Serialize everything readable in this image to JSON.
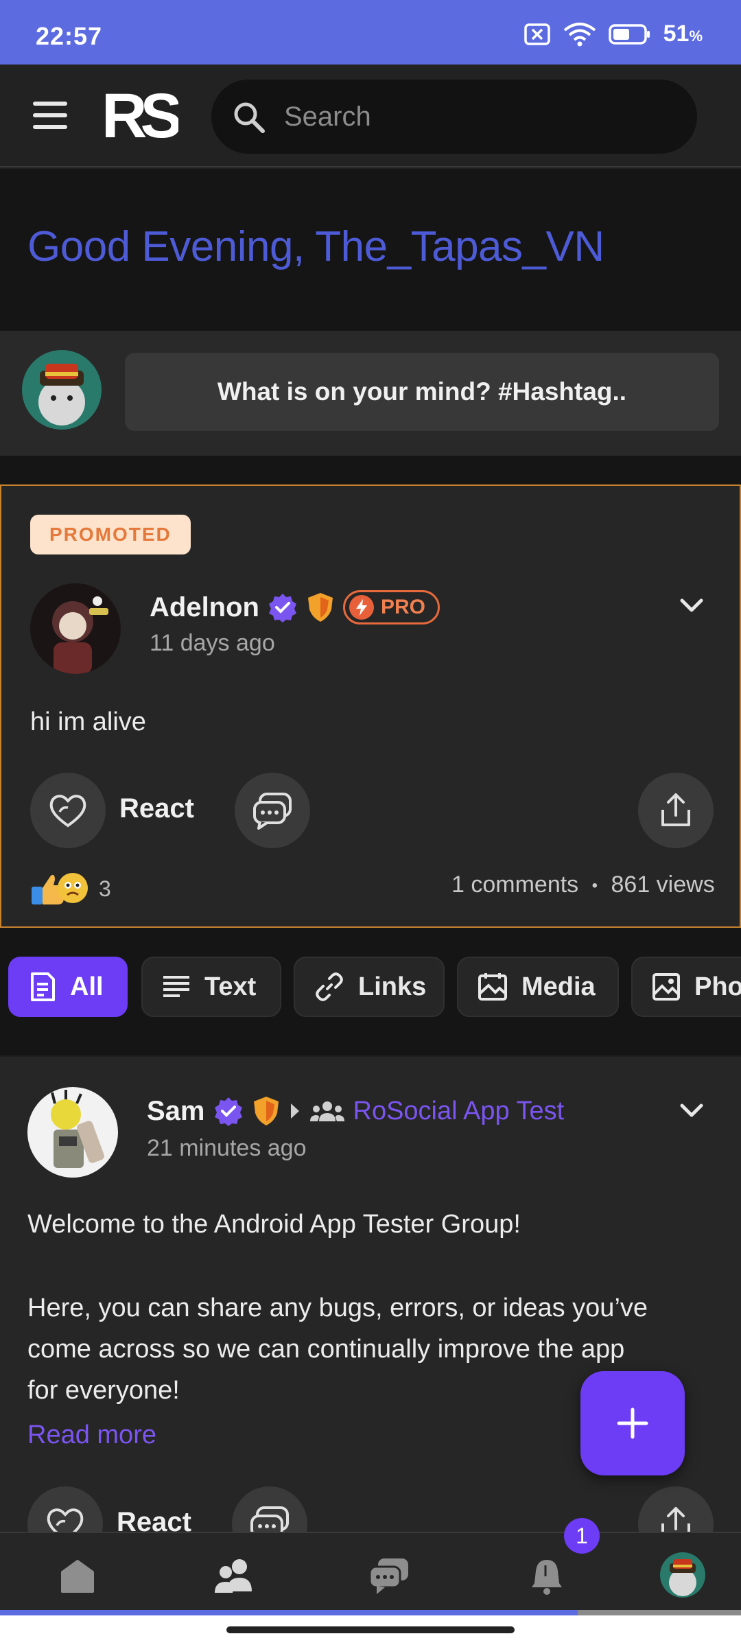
{
  "status_bar": {
    "time": "22:57",
    "battery_pct": "51",
    "battery_unit": "%"
  },
  "header": {
    "logo_text": "RS",
    "search_placeholder": "Search"
  },
  "greeting": {
    "text": "Good Evening, The_Tapas_VN"
  },
  "composer": {
    "prompt": "What is on your mind? #Hashtag.."
  },
  "promoted_post": {
    "badge": "PROMOTED",
    "author": "Adelnon",
    "pro_label": "PRO",
    "time": "11 days ago",
    "body": "hi im alive",
    "react_label": "React",
    "reaction_count": "3",
    "comments": "1 comments",
    "views": "861 views",
    "separator": "•"
  },
  "filters": [
    {
      "label": "All",
      "icon": "document-icon",
      "active": true
    },
    {
      "label": "Text",
      "icon": "text-lines-icon",
      "active": false
    },
    {
      "label": "Links",
      "icon": "link-icon",
      "active": false
    },
    {
      "label": "Media",
      "icon": "media-icon",
      "active": false
    },
    {
      "label": "Pho",
      "icon": "photo-icon",
      "active": false
    }
  ],
  "post": {
    "author": "Sam",
    "group": "RoSocial App Test",
    "time": "21 minutes ago",
    "body_line1": "Welcome to the Android App Tester Group!",
    "body_line2": "Here, you can share any bugs, errors, or ideas you’ve",
    "body_line3": "come across so we can continually improve the app",
    "body_line4": "for everyone!",
    "read_more": "Read more",
    "react_label": "React"
  },
  "bottom_nav": {
    "items": [
      "home-icon",
      "friends-icon",
      "chat-icon",
      "bell-icon",
      "profile-avatar"
    ],
    "notification_count": "1"
  },
  "progress_fraction": 0.78,
  "colors": {
    "accent": "#6d3cf5",
    "status_bar": "#5c6be0",
    "greeting": "#4e5bd6",
    "promo_border": "#c9822e"
  }
}
